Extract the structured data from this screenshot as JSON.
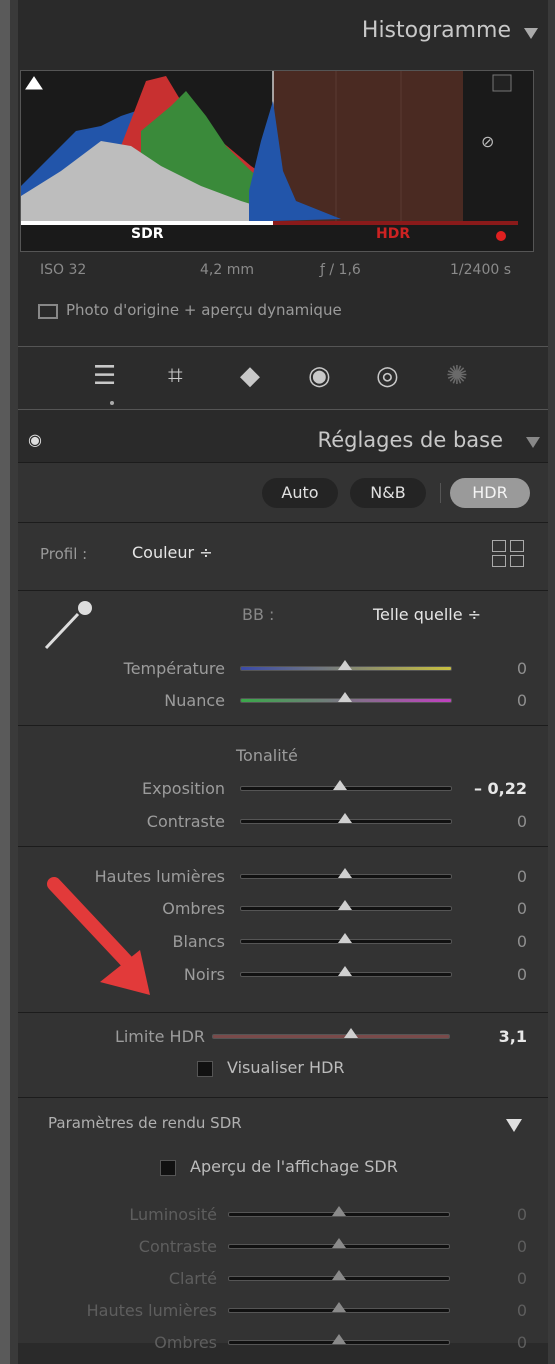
{
  "histogram": {
    "title": "Histogramme",
    "sdr_label": "SDR",
    "hdr_label": "HDR",
    "iso": "ISO 32",
    "focal": "4,2 mm",
    "aperture": "ƒ / 1,6",
    "shutter": "1/2400 s",
    "source_label": "Photo d'origine + aperçu dynamique"
  },
  "toolbar": {
    "tools": [
      "edit-sliders-icon",
      "crop-icon",
      "eraser-icon",
      "redeye-icon",
      "mask-icon",
      "preset-icon"
    ]
  },
  "basic": {
    "title": "Réglages de base",
    "buttons": {
      "auto": "Auto",
      "nb": "N&B",
      "hdr": "HDR"
    },
    "profile_label": "Profil :",
    "profile_value": "Couleur ÷",
    "wb_label": "BB :",
    "wb_value": "Telle quelle ÷",
    "temperature": {
      "label": "Température",
      "value": "0"
    },
    "nuance": {
      "label": "Nuance",
      "value": "0"
    },
    "tonality": "Tonalité",
    "exposure": {
      "label": "Exposition",
      "value": "– 0,22"
    },
    "contrast": {
      "label": "Contraste",
      "value": "0"
    },
    "highlights": {
      "label": "Hautes lumières",
      "value": "0"
    },
    "shadows": {
      "label": "Ombres",
      "value": "0"
    },
    "whites": {
      "label": "Blancs",
      "value": "0"
    },
    "blacks": {
      "label": "Noirs",
      "value": "0"
    },
    "hdr_limit": {
      "label": "Limite HDR",
      "value": "3,1"
    },
    "visualize_hdr": "Visualiser HDR"
  },
  "sdr": {
    "title": "Paramètres de rendu SDR",
    "preview": "Aperçu de l'affichage SDR",
    "luminosity": {
      "label": "Luminosité",
      "value": "0"
    },
    "contrast": {
      "label": "Contraste",
      "value": "0"
    },
    "clarity": {
      "label": "Clarté",
      "value": "0"
    },
    "highlights": {
      "label": "Hautes lumières",
      "value": "0"
    },
    "shadows": {
      "label": "Ombres",
      "value": "0"
    }
  },
  "colors": {
    "accent": "#e23a3a",
    "hdr_red": "#cc2222"
  }
}
